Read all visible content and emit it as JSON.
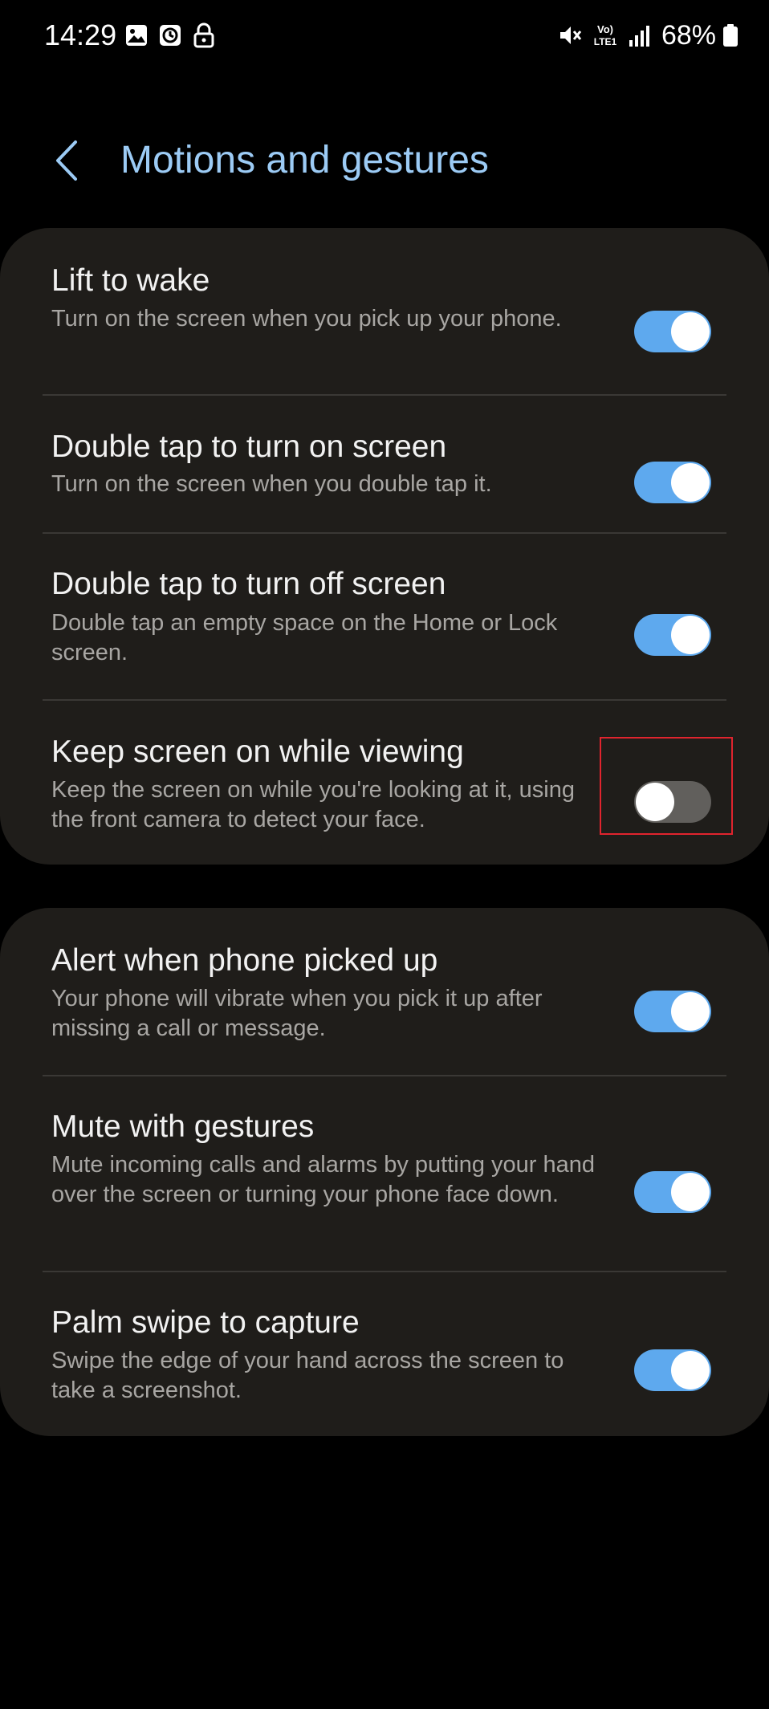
{
  "status_bar": {
    "time": "14:29",
    "left_icons": [
      "gallery-icon",
      "alarm-icon",
      "lock-icon"
    ],
    "right_icons": [
      "mute-icon",
      "volte-icon",
      "signal-icon"
    ],
    "volte_label_top": "Vo)",
    "volte_label_bottom": "LTE1",
    "battery": "68%"
  },
  "header": {
    "title": "Motions and gestures"
  },
  "colors": {
    "accent": "#5ea9ee",
    "title": "#9ccbf5",
    "card": "#1f1d1a",
    "toggle_off": "#615f5c",
    "highlight": "#e0242e"
  },
  "group1": [
    {
      "title": "Lift to wake",
      "desc": "Turn on the screen when you pick up your phone.",
      "enabled": true
    },
    {
      "title": "Double tap to turn on screen",
      "desc": "Turn on the screen when you double tap it.",
      "enabled": true
    },
    {
      "title": "Double tap to turn off screen",
      "desc": "Double tap an empty space on the Home or Lock screen.",
      "enabled": true
    },
    {
      "title": "Keep screen on while viewing",
      "desc": "Keep the screen on while you're looking at it, using the front camera to detect your face.",
      "enabled": false
    }
  ],
  "group2": [
    {
      "title": "Alert when phone picked up",
      "desc": "Your phone will vibrate when you pick it up after missing a call or message.",
      "enabled": true
    },
    {
      "title": "Mute with gestures",
      "desc": "Mute incoming calls and alarms by putting your hand over the screen or turning your phone face down.",
      "enabled": true
    },
    {
      "title": "Palm swipe to capture",
      "desc": "Swipe the edge of your hand across the screen to take a screenshot.",
      "enabled": true
    }
  ]
}
